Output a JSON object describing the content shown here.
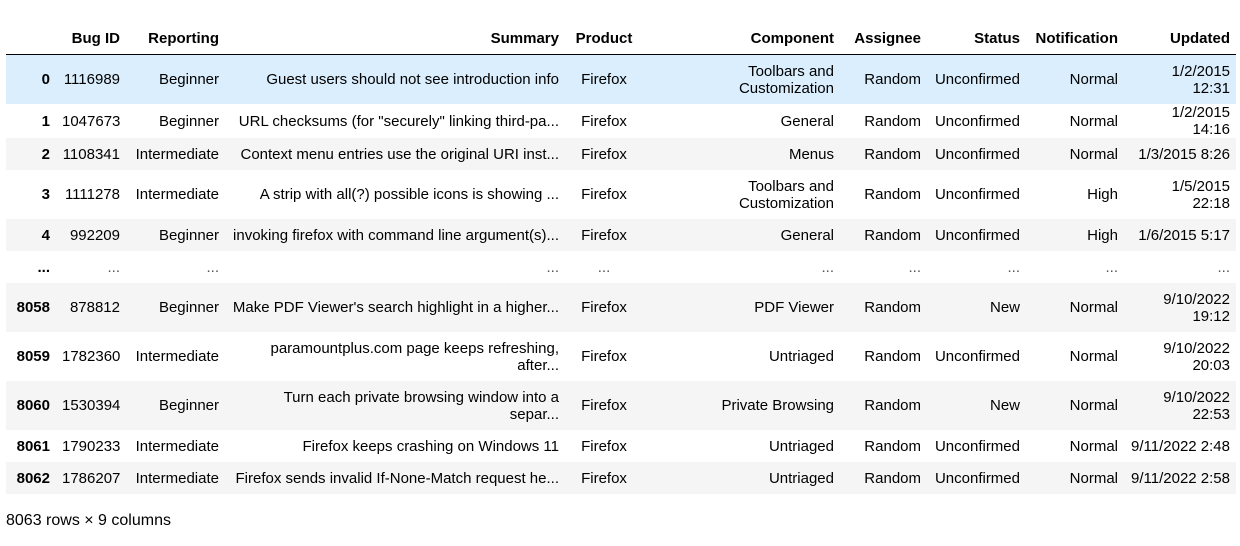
{
  "columns": {
    "bug_id": "Bug ID",
    "reporting": "Reporting",
    "summary": "Summary",
    "product": "Product",
    "component": "Component",
    "assignee": "Assignee",
    "status": "Status",
    "notification": "Notification",
    "updated": "Updated"
  },
  "rows": [
    {
      "idx": "0",
      "bug_id": "1116989",
      "reporting": "Beginner",
      "summary": "Guest users should not see introduction info",
      "product": "Firefox",
      "component": "Toolbars and Customization",
      "assignee": "Random",
      "status": "Unconfirmed",
      "notification": "Normal",
      "updated": "1/2/2015 12:31"
    },
    {
      "idx": "1",
      "bug_id": "1047673",
      "reporting": "Beginner",
      "summary": "URL checksums (for \"securely\" linking third-pa...",
      "product": "Firefox",
      "component": "General",
      "assignee": "Random",
      "status": "Unconfirmed",
      "notification": "Normal",
      "updated": "1/2/2015 14:16"
    },
    {
      "idx": "2",
      "bug_id": "1108341",
      "reporting": "Intermediate",
      "summary": "Context menu entries use the original URI inst...",
      "product": "Firefox",
      "component": "Menus",
      "assignee": "Random",
      "status": "Unconfirmed",
      "notification": "Normal",
      "updated": "1/3/2015 8:26"
    },
    {
      "idx": "3",
      "bug_id": "1111278",
      "reporting": "Intermediate",
      "summary": "A strip with all(?) possible icons is showing ...",
      "product": "Firefox",
      "component": "Toolbars and Customization",
      "assignee": "Random",
      "status": "Unconfirmed",
      "notification": "High",
      "updated": "1/5/2015 22:18"
    },
    {
      "idx": "4",
      "bug_id": "992209",
      "reporting": "Beginner",
      "summary": "invoking firefox with command line argument(s)...",
      "product": "Firefox",
      "component": "General",
      "assignee": "Random",
      "status": "Unconfirmed",
      "notification": "High",
      "updated": "1/6/2015 5:17"
    },
    {
      "idx": "...",
      "bug_id": "...",
      "reporting": "...",
      "summary": "...",
      "product": "...",
      "component": "...",
      "assignee": "...",
      "status": "...",
      "notification": "...",
      "updated": "..."
    },
    {
      "idx": "8058",
      "bug_id": "878812",
      "reporting": "Beginner",
      "summary": "Make PDF Viewer's search highlight in a higher...",
      "product": "Firefox",
      "component": "PDF Viewer",
      "assignee": "Random",
      "status": "New",
      "notification": "Normal",
      "updated": "9/10/2022 19:12"
    },
    {
      "idx": "8059",
      "bug_id": "1782360",
      "reporting": "Intermediate",
      "summary": "paramountplus.com page keeps refreshing, after...",
      "product": "Firefox",
      "component": "Untriaged",
      "assignee": "Random",
      "status": "Unconfirmed",
      "notification": "Normal",
      "updated": "9/10/2022 20:03"
    },
    {
      "idx": "8060",
      "bug_id": "1530394",
      "reporting": "Beginner",
      "summary": "Turn each private browsing window into a separ...",
      "product": "Firefox",
      "component": "Private Browsing",
      "assignee": "Random",
      "status": "New",
      "notification": "Normal",
      "updated": "9/10/2022 22:53"
    },
    {
      "idx": "8061",
      "bug_id": "1790233",
      "reporting": "Intermediate",
      "summary": "Firefox keeps crashing on Windows 11",
      "product": "Firefox",
      "component": "Untriaged",
      "assignee": "Random",
      "status": "Unconfirmed",
      "notification": "Normal",
      "updated": "9/11/2022 2:48"
    },
    {
      "idx": "8062",
      "bug_id": "1786207",
      "reporting": "Intermediate",
      "summary": "Firefox sends invalid If-None-Match request he...",
      "product": "Firefox",
      "component": "Untriaged",
      "assignee": "Random",
      "status": "Unconfirmed",
      "notification": "Normal",
      "updated": "9/11/2022 2:58"
    }
  ],
  "shape_text": "8063 rows × 9 columns",
  "colors": {
    "hover_row": "#daeefd",
    "stripe_row": "#f5f5f5",
    "header_rule": "#000000"
  }
}
